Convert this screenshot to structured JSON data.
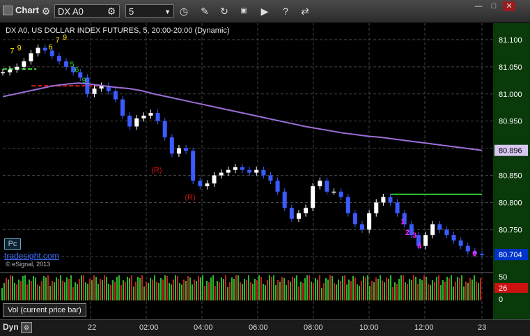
{
  "toolbar": {
    "title": "Chart",
    "symbol": "DX A0",
    "interval": "5",
    "icons": [
      "chart-icon",
      "symbol-settings-icon",
      "refresh-icon",
      "draw-icon",
      "cycle-icon",
      "snapshot-icon",
      "play-icon",
      "help-icon",
      "link-icon"
    ]
  },
  "window_controls": {
    "minimize": "—",
    "maximize": "□",
    "close": "✕"
  },
  "chart_header": "DX A0, US DOLLAR INDEX FUTURES, 5, 20:00-20:00 (Dynamic)",
  "branding": {
    "pc_label": "Pc",
    "site": "tradesight.com",
    "copyright": "© eSignal, 2013"
  },
  "volume_label": "Vol (current price bar)",
  "bottom": {
    "dyn": "Dyn",
    "x_ticks": [
      "22",
      "02:00",
      "04:00",
      "06:00",
      "08:00",
      "10:00",
      "12:00",
      "23"
    ]
  },
  "colors": {
    "up": "#ffffff",
    "down": "#3b5bff",
    "ma": "#9b6fd6",
    "grid": "#444444",
    "axis_bg": "#0a3a0a",
    "axis_text": "#ffffff",
    "last_price_bg": "#0033cc",
    "ma_label_bg": "#d8c8f0",
    "green_level": "#2fd02f",
    "red_level": "#d02020",
    "vol_up": "#2db82d",
    "vol_down": "#c82020"
  },
  "chart_data": {
    "type": "candlestick",
    "price_axis": {
      "ticks": [
        81.1,
        81.05,
        81.0,
        80.95,
        80.9,
        80.85,
        80.8,
        80.75,
        80.7
      ],
      "labels": [
        "81.100",
        "81.050",
        "81.000",
        "80.950",
        "80.900",
        "80.850",
        "80.800",
        "80.750",
        "80.700"
      ],
      "ylim": [
        80.676,
        81.123
      ]
    },
    "last_price": "80.704",
    "ma_value": "80.896",
    "series": [
      {
        "name": "price",
        "close": [
          81.04,
          81.045,
          81.05,
          81.06,
          81.075,
          81.085,
          81.08,
          81.07,
          81.06,
          81.05,
          81.04,
          81.03,
          81.0,
          81.01,
          81.015,
          81.005,
          80.99,
          80.96,
          80.94,
          80.955,
          80.96,
          80.965,
          80.95,
          80.92,
          80.89,
          80.9,
          80.895,
          80.84,
          80.83,
          80.835,
          80.85,
          80.855,
          80.86,
          80.865,
          80.86,
          80.855,
          80.86,
          80.85,
          80.84,
          80.82,
          80.79,
          80.77,
          80.78,
          80.79,
          80.83,
          80.84,
          80.82,
          80.82,
          80.81,
          80.78,
          80.76,
          80.75,
          80.78,
          80.8,
          80.81,
          80.8,
          80.78,
          80.76,
          80.74,
          80.72,
          80.74,
          80.76,
          80.75,
          80.74,
          80.73,
          80.72,
          80.71,
          80.705,
          80.704
        ]
      },
      {
        "name": "ma",
        "values": [
          80.995,
          81.0,
          81.005,
          81.01,
          81.015,
          81.018,
          81.02,
          81.018,
          81.015,
          81.012,
          81.01,
          81.006,
          81.0,
          80.995,
          80.99,
          80.985,
          80.98,
          80.975,
          80.97,
          80.965,
          80.96,
          80.955,
          80.95,
          80.945,
          80.94,
          80.936,
          80.932,
          80.928,
          80.925,
          80.922,
          80.92,
          80.917,
          80.914,
          80.911,
          80.908,
          80.905,
          80.902,
          80.899,
          80.896
        ]
      }
    ],
    "levels": [
      {
        "color": "green",
        "y": 81.046,
        "x": [
          0.0,
          0.07
        ]
      },
      {
        "color": "red",
        "y": 81.015,
        "x": [
          0.06,
          0.2
        ]
      },
      {
        "color": "green",
        "y": 80.815,
        "x": [
          0.81,
          1.0
        ]
      }
    ],
    "annotations": [
      {
        "text": "7",
        "color": "yellow",
        "x": 0.015,
        "y": 81.075
      },
      {
        "text": "9",
        "color": "yellow",
        "x": 0.03,
        "y": 81.08
      },
      {
        "text": "6",
        "color": "yellow",
        "x": 0.095,
        "y": 81.082
      },
      {
        "text": "7",
        "color": "yellow",
        "x": 0.11,
        "y": 81.095
      },
      {
        "text": "9",
        "color": "yellow",
        "x": 0.125,
        "y": 81.1
      },
      {
        "text": "5",
        "color": "green",
        "x": 0.14,
        "y": 81.05
      },
      {
        "text": "6",
        "color": "green",
        "x": 0.15,
        "y": 81.04
      },
      {
        "text": "9",
        "color": "green",
        "x": 0.165,
        "y": 81.02
      },
      {
        "text": "(R)",
        "color": "red",
        "x": 0.31,
        "y": 80.855
      },
      {
        "text": "(R)",
        "color": "red",
        "x": 0.38,
        "y": 80.805
      },
      {
        "text": "1",
        "color": "magenta",
        "x": 0.83,
        "y": 80.76
      },
      {
        "text": "2",
        "color": "magenta",
        "x": 0.84,
        "y": 80.74
      },
      {
        "text": "3",
        "color": "magenta",
        "x": 0.855,
        "y": 80.735
      },
      {
        "text": "4",
        "color": "magenta",
        "x": 0.865,
        "y": 80.715
      },
      {
        "text": "6",
        "color": "magenta",
        "x": 0.98,
        "y": 80.702
      }
    ],
    "volume_axis": {
      "labels": [
        "50",
        "26",
        "0"
      ],
      "current": "26"
    }
  }
}
